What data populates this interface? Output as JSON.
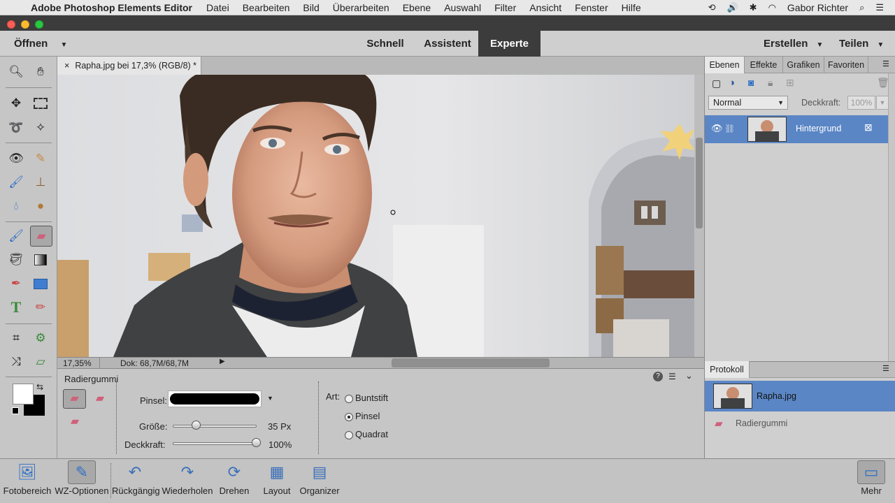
{
  "menubar": {
    "app_name": "Adobe Photoshop Elements Editor",
    "items": [
      "Datei",
      "Bearbeiten",
      "Bild",
      "Überarbeiten",
      "Ebene",
      "Auswahl",
      "Filter",
      "Ansicht",
      "Fenster",
      "Hilfe"
    ],
    "user": "Gabor Richter"
  },
  "modebar": {
    "open_label": "Öffnen",
    "modes": [
      "Schnell",
      "Assistent",
      "Experte"
    ],
    "active_mode": "Experte",
    "create_label": "Erstellen",
    "share_label": "Teilen"
  },
  "document": {
    "tab_title": "Rapha.jpg bei 17,3% (RGB/8) *",
    "zoom": "17,35%",
    "doc_size": "Dok: 68,7M/68,7M"
  },
  "options": {
    "tool_name": "Radiergummi",
    "brush_label": "Pinsel:",
    "size_label": "Größe:",
    "size_value": "35 Px",
    "size_fraction": 0.28,
    "opacity_label": "Deckkraft:",
    "opacity_value": "100%",
    "opacity_fraction": 1.0,
    "type_label": "Art:",
    "type_options": [
      "Buntstift",
      "Pinsel",
      "Quadrat"
    ],
    "type_selected": "Pinsel"
  },
  "layers_panel": {
    "tabs": [
      "Ebenen",
      "Effekte",
      "Grafiken",
      "Favoriten"
    ],
    "active_tab": "Ebenen",
    "blend_mode": "Normal",
    "opacity_label": "Deckkraft:",
    "opacity_value": "100%",
    "layers": [
      {
        "name": "Hintergrund"
      }
    ]
  },
  "history_panel": {
    "title": "Protokoll",
    "items": [
      "Rapha.jpg",
      "Radiergummi"
    ]
  },
  "bottombar": {
    "buttons": [
      "Fotobereich",
      "WZ-Optionen",
      "Rückgängig",
      "Wiederholen",
      "Drehen",
      "Layout",
      "Organizer"
    ],
    "more_label": "Mehr"
  },
  "colors": {
    "accent_blue": "#5b86c5",
    "active_mode_bg": "#3c3c3c"
  }
}
